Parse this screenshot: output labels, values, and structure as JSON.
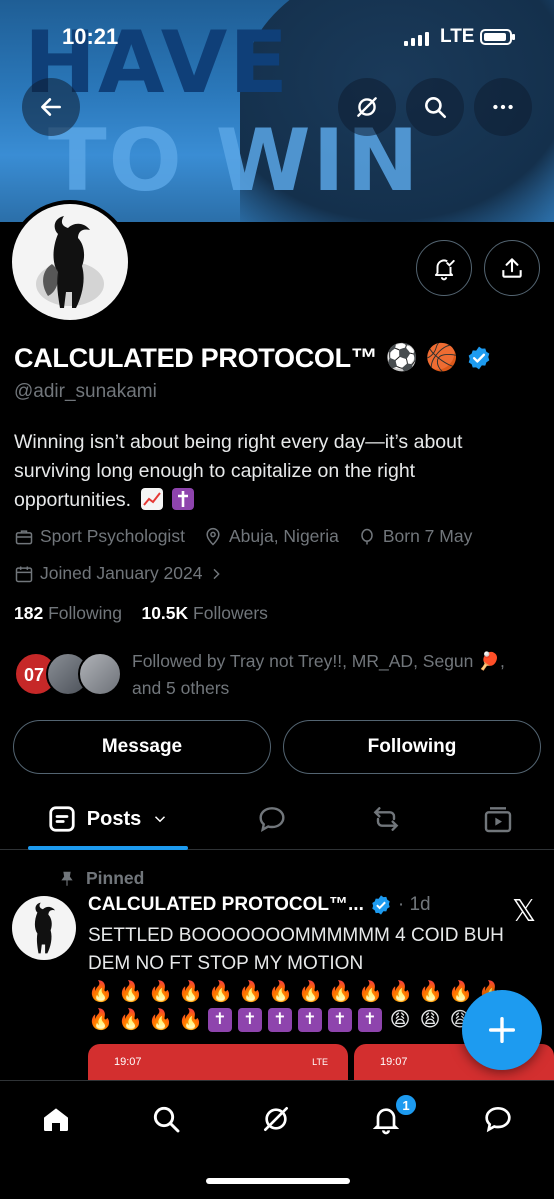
{
  "status_bar": {
    "time": "10:21",
    "network": "LTE"
  },
  "banner": {
    "line1": "HAVE",
    "line2": "TO WIN"
  },
  "profile": {
    "name": "CALCULATED PROTOCOL™",
    "name_emojis": [
      "⚽",
      "🏀"
    ],
    "handle": "@adir_sunakami",
    "bio": "Winning isn’t about being right every day—it’s about surviving long enough to capitalize on the right opportunities.",
    "profession": "Sport Psychologist",
    "location": "Abuja, Nigeria",
    "birthday": "Born 7 May",
    "joined": "Joined January 2024",
    "following_count": "182",
    "following_label": "Following",
    "followers_count": "10.5K",
    "followers_label": "Followers",
    "followed_by": "Followed by Tray not Trey!!, MR_AD, Segun 🏓, and 5 others",
    "followed_avatar_jersey": "07"
  },
  "buttons": {
    "message": "Message",
    "following": "Following"
  },
  "tabs": {
    "posts": "Posts"
  },
  "pinned_post": {
    "pinned_label": "Pinned",
    "author": "CALCULATED PROTOCOL™...",
    "date": "· 1d",
    "text": "SETTLED BOOOOOOOMMMMMM 4 COID BUH DEM NO FT STOP MY MOTION",
    "media_times": [
      "19:07",
      "19:07"
    ],
    "media_network": "LTE"
  },
  "notifications_badge": "1",
  "colors": {
    "accent": "#1d9bf0",
    "background": "#000000",
    "muted": "#71767b",
    "border": "#536471"
  }
}
